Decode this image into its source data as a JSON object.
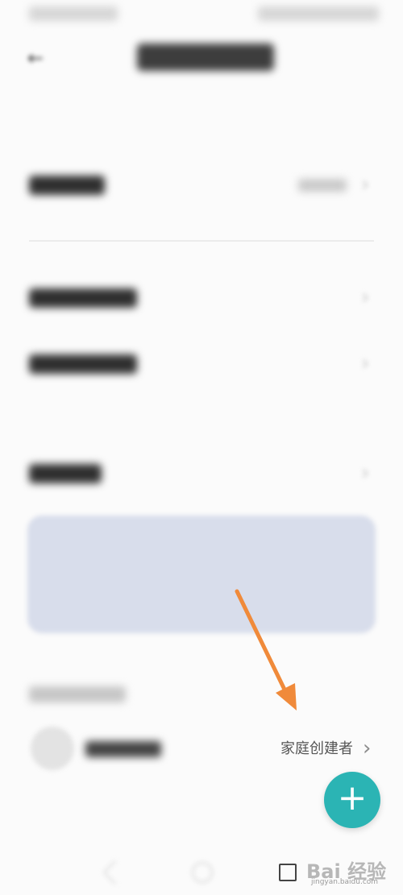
{
  "member": {
    "role": "家庭创建者",
    "chevron": "›"
  },
  "fab": {
    "label": "+"
  },
  "icons": {
    "back": "arrow-left-icon",
    "chevron": "chevron-right-icon",
    "add": "plus-icon"
  },
  "chevrons": {
    "symbol": "›"
  },
  "header": {
    "back_symbol": "←"
  },
  "watermark": {
    "logo": "Bai 经验",
    "site": "jingyan.baidu.com"
  },
  "colors": {
    "accent": "#2bb4b4",
    "banner": "#d8ddeb",
    "arrow": "#f08a3a"
  }
}
